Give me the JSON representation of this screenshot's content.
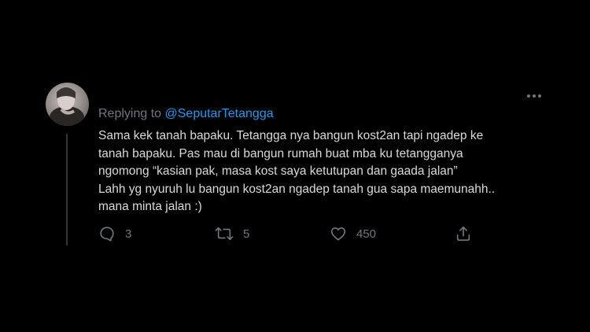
{
  "tweet": {
    "replying_prefix": "Replying to",
    "replying_handle": "@SeputarTetangga",
    "lines": [
      "Sama kek tanah bapaku. Tetangga nya bangun kost2an tapi ngadep ke",
      "tanah bapaku. Pas mau di bangun rumah buat mba ku tetangganya",
      "ngomong “kasian pak, masa kost saya ketutupan dan gaada jalan”",
      "Lahh yg nyuruh lu bangun kost2an ngadep tanah gua sapa maemunahh..",
      "mana minta jalan :)"
    ],
    "actions": {
      "reply_count": "3",
      "retweet_count": "5",
      "like_count": "450"
    }
  },
  "colors": {
    "background": "#000000",
    "text": "#d9d9d9",
    "muted": "#6e767d",
    "link": "#1d9bf0"
  },
  "icons": [
    "more-icon",
    "reply-icon",
    "retweet-icon",
    "like-icon",
    "share-icon"
  ]
}
